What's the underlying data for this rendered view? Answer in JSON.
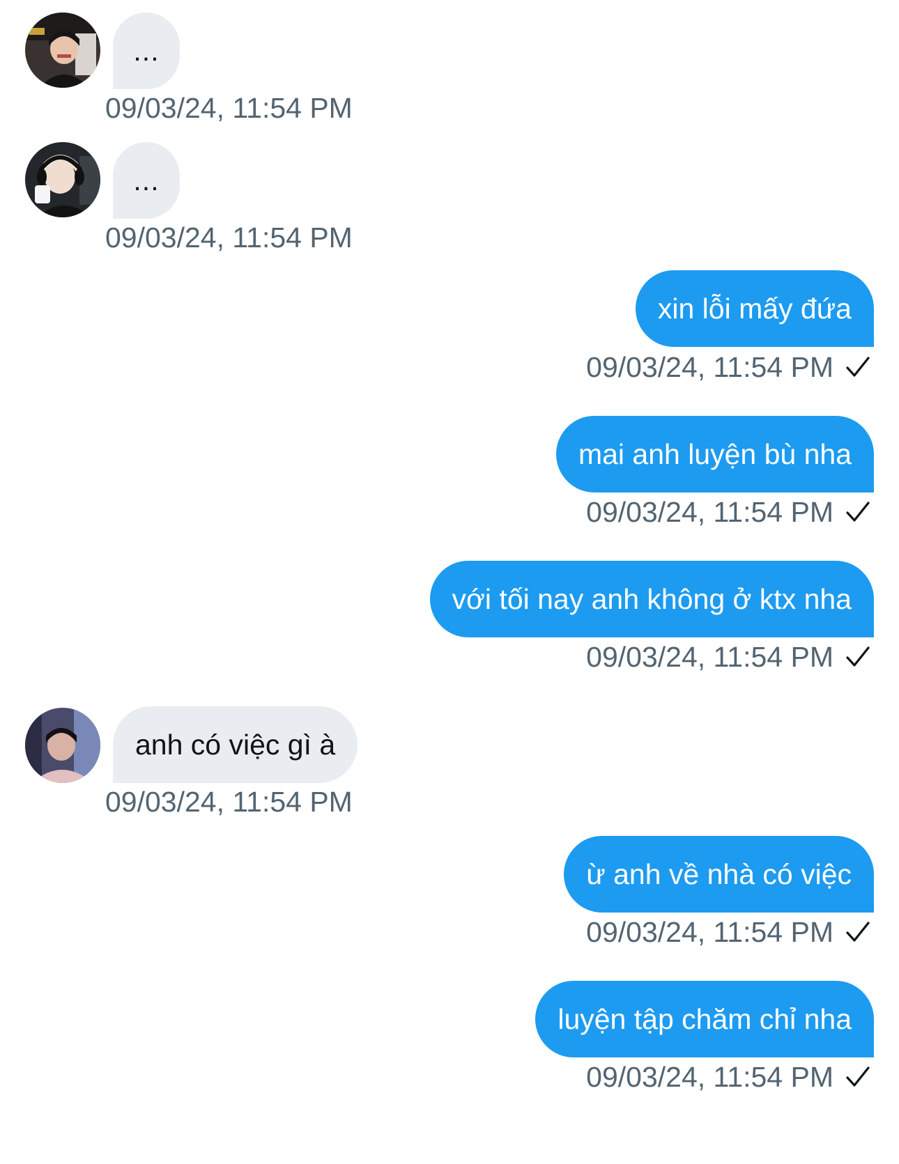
{
  "messages": [
    {
      "direction": "incoming",
      "avatar": "avatar-streamer",
      "text": "...",
      "time": "09/03/24, 11:54 PM"
    },
    {
      "direction": "incoming",
      "avatar": "avatar-headset",
      "text": "...",
      "time": "09/03/24, 11:54 PM"
    },
    {
      "direction": "outgoing",
      "text": "xin lỗi mấy đứa",
      "time": "09/03/24, 11:54 PM",
      "status_icon": "check-icon"
    },
    {
      "direction": "outgoing",
      "text": "mai anh luyện bù nha",
      "time": "09/03/24, 11:54 PM",
      "status_icon": "check-icon"
    },
    {
      "direction": "outgoing",
      "text": "với tối nay anh không ở ktx nha",
      "time": "09/03/24, 11:54 PM",
      "status_icon": "check-icon"
    },
    {
      "direction": "incoming",
      "avatar": "avatar-player",
      "text": "anh có việc gì à",
      "time": "09/03/24, 11:54 PM"
    },
    {
      "direction": "outgoing",
      "text": "ừ anh về nhà có việc",
      "time": "09/03/24, 11:54 PM",
      "status_icon": "check-icon"
    },
    {
      "direction": "outgoing",
      "text": "luyện tập chăm chỉ nha",
      "time": "09/03/24, 11:54 PM",
      "status_icon": "check-icon"
    }
  ],
  "colors": {
    "incoming_bubble": "#e9edf1",
    "outgoing_bubble": "#1d9bf0",
    "timestamp": "#536471",
    "incoming_text": "#0f1419",
    "outgoing_text": "#ffffff"
  }
}
